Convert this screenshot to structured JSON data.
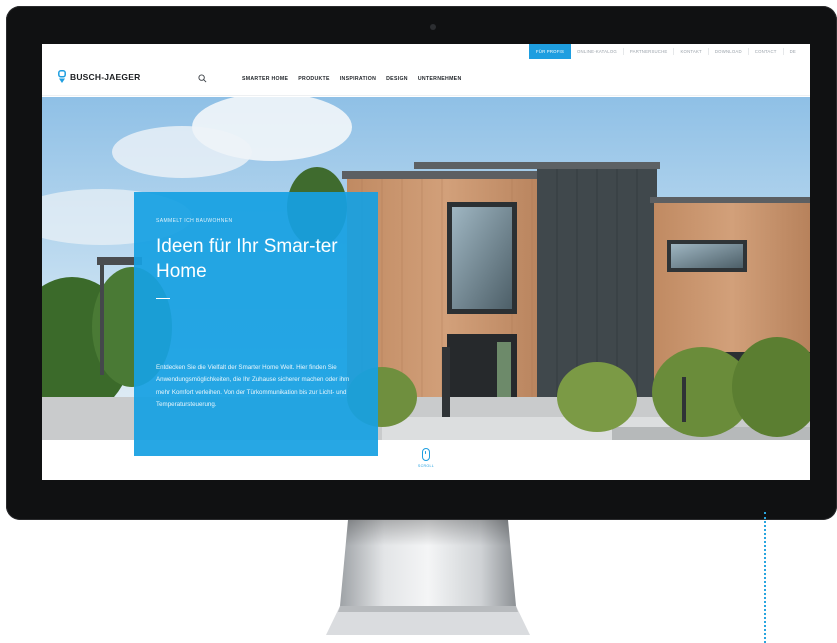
{
  "topbar": {
    "items": [
      "FÜR PROFIS",
      "ONLINE-KATALOG",
      "PARTNERSUCHE",
      "KONTAKT",
      "DOWNLOAD",
      "CONTACT",
      "DE"
    ]
  },
  "brand": {
    "name": "BUSCH-JAEGER"
  },
  "mainnav": {
    "items": [
      "SMARTER HOME",
      "PRODUKTE",
      "INSPIRATION",
      "DESIGN",
      "UNTERNEHMEN"
    ]
  },
  "hero": {
    "eyebrow": "SAMMELT ICH BAUWOHNEN",
    "headline": "Ideen für Ihr Smar-ter Home",
    "body": "Entdecken Sie die Vielfalt der Smarter Home Welt. Hier finden Sie Anwendungsmöglichkeiten, die Ihr Zuhause sicherer machen oder ihm mehr Komfort verleihen. Von der Türkommunikation bis zur Licht- und Temperatursteuerung."
  },
  "scroll": {
    "label": "SCROLL"
  },
  "colors": {
    "accent": "#1E9EE0",
    "teaser": "#17A0E2",
    "bezel": "#101112"
  }
}
